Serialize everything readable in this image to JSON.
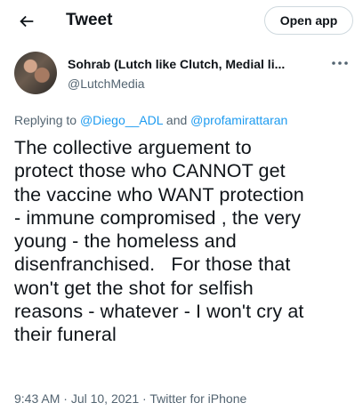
{
  "header": {
    "back_icon": "arrow-left-icon",
    "title": "Tweet",
    "open_app_label": "Open app"
  },
  "author": {
    "display_name": "Sohrab (Lutch like Clutch, Medial li...",
    "handle": "@LutchMedia",
    "more_icon": "more-horizontal-icon"
  },
  "reply": {
    "prefix": "Replying to ",
    "user1": "@Diego__ADL",
    "connector": " and ",
    "user2": "@profamirattaran"
  },
  "tweet": {
    "text": "The collective arguement to\nprotect those who CANNOT get\nthe vaccine who WANT protection\n- immune compromised , the very\nyoung - the homeless and\ndisenfranchised.   For those that\nwon't get the shot for selfish\nreasons - whatever - I won't cry at\ntheir funeral"
  },
  "meta": {
    "time": "9:43 AM",
    "sep1": " · ",
    "date": "Jul 10, 2021",
    "sep2": " · ",
    "source": "Twitter for iPhone"
  },
  "colors": {
    "link": "#1d9bf0",
    "secondary_text": "#536471",
    "primary_text": "#0f1419",
    "border": "#cfd9de"
  }
}
